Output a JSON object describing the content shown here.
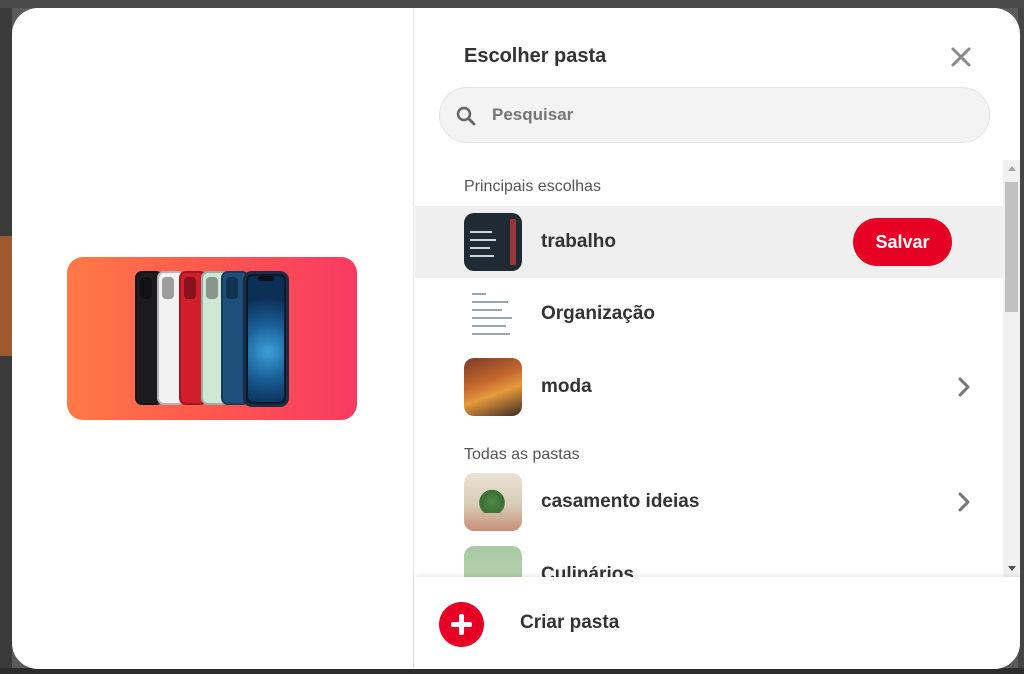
{
  "modal": {
    "title": "Escolher pasta",
    "close_icon": "close-icon"
  },
  "search": {
    "placeholder": "Pesquisar",
    "value": "",
    "icon": "search-icon"
  },
  "sections": {
    "top": "Principais escolhas",
    "all": "Todas as pastas"
  },
  "boards": {
    "top": [
      {
        "name": "trabalho",
        "has_save_button": true
      },
      {
        "name": "Organização",
        "has_save_button": false
      },
      {
        "name": "moda",
        "has_chevron": true
      }
    ],
    "all": [
      {
        "name": "casamento ideias",
        "has_chevron": true
      },
      {
        "name": "Culinários"
      }
    ]
  },
  "save_button": {
    "label": "Salvar"
  },
  "footer": {
    "create_label": "Criar pasta"
  },
  "colors": {
    "accent": "#e60023",
    "hover_row": "#efefef",
    "text": "#333333"
  }
}
